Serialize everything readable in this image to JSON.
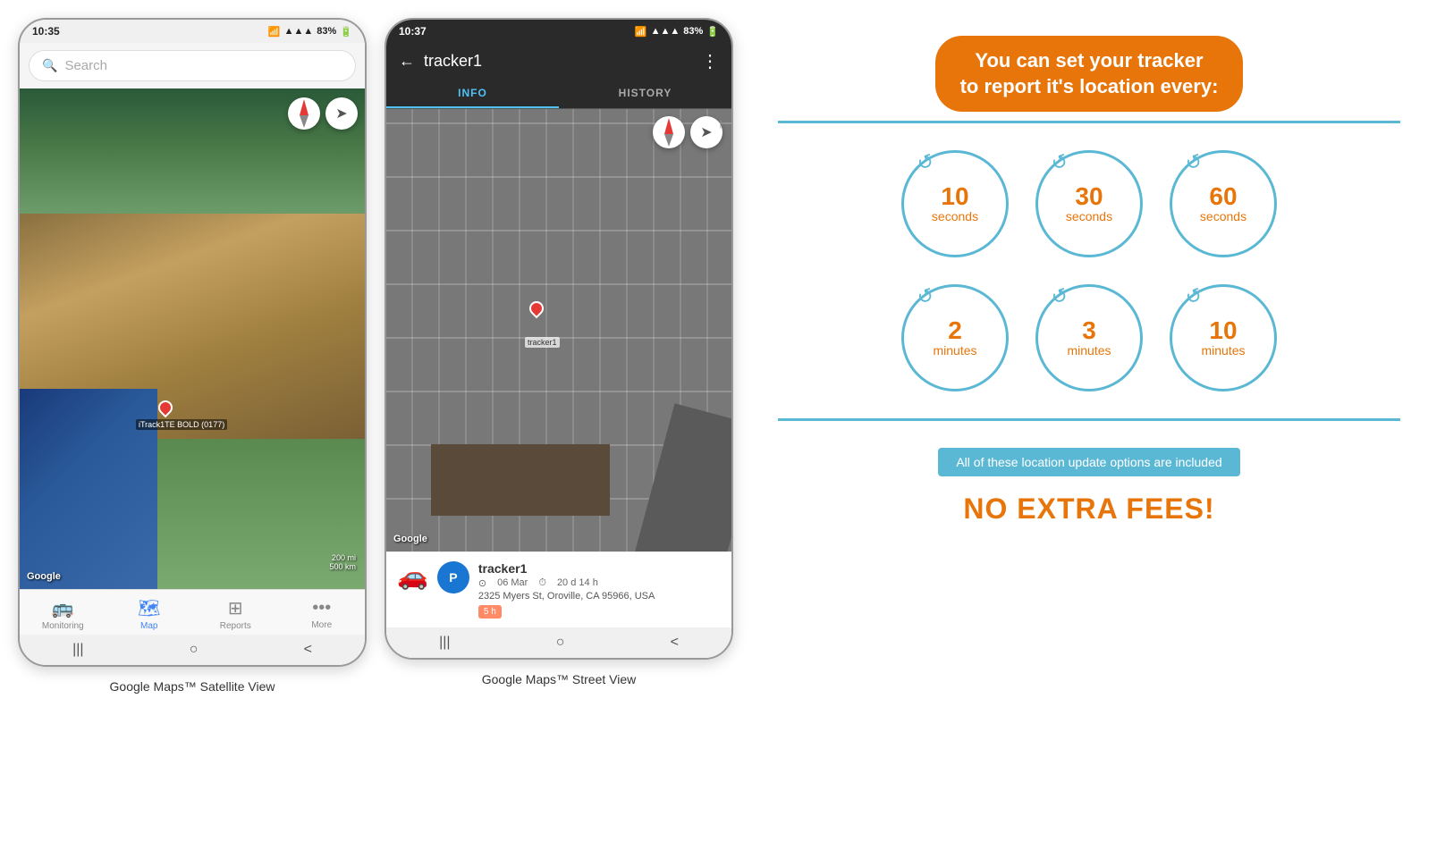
{
  "phone1": {
    "status_bar": {
      "time": "10:35",
      "signal": "▲▲▲",
      "battery": "83%"
    },
    "search": {
      "placeholder": "Search"
    },
    "map": {
      "tracker_label": "iTrack1TE BOLD (0177)",
      "google_logo": "Google",
      "scale_top": "200 mi",
      "scale_bottom": "500 km"
    },
    "nav": {
      "items": [
        {
          "label": "Monitoring",
          "icon": "🚌",
          "active": false
        },
        {
          "label": "Map",
          "icon": "🗺",
          "active": true
        },
        {
          "label": "Reports",
          "icon": "⊞",
          "active": false
        },
        {
          "label": "More",
          "icon": "•••",
          "active": false
        }
      ]
    },
    "gesture_bar": {
      "back": "|||",
      "home": "○",
      "recent": "<"
    },
    "caption": "Google Maps™ Satellite View"
  },
  "phone2": {
    "status_bar": {
      "time": "10:37",
      "signal": "▲▲▲",
      "battery": "83%"
    },
    "header": {
      "back_icon": "←",
      "title": "tracker1",
      "menu_icon": "⋮"
    },
    "tabs": [
      {
        "label": "INFO",
        "active": true
      },
      {
        "label": "HISTORY",
        "active": false
      }
    ],
    "map": {
      "tracker_label": "tracker1",
      "google_logo": "Google"
    },
    "tracker_card": {
      "name": "tracker1",
      "icon_letter": "P",
      "date": "06 Mar",
      "duration": "20 d 14 h",
      "address": "2325 Myers St, Oroville, CA 95966, USA",
      "badge": "5 h"
    },
    "gesture_bar": {
      "back": "|||",
      "home": "○",
      "recent": "<"
    },
    "caption": "Google Maps™ Street View"
  },
  "info_panel": {
    "headline": "You can set your tracker\nto report it's location every:",
    "accent_color": "#5bb8d4",
    "headline_color": "#e8750a",
    "circles_row1": [
      {
        "number": "10",
        "unit": "seconds"
      },
      {
        "number": "30",
        "unit": "seconds"
      },
      {
        "number": "60",
        "unit": "seconds"
      }
    ],
    "circles_row2": [
      {
        "number": "2",
        "unit": "minutes"
      },
      {
        "number": "3",
        "unit": "minutes"
      },
      {
        "number": "10",
        "unit": "minutes"
      }
    ],
    "banner_text": "All of these location update options are included",
    "no_fees_text": "NO EXTRA FEES!"
  }
}
